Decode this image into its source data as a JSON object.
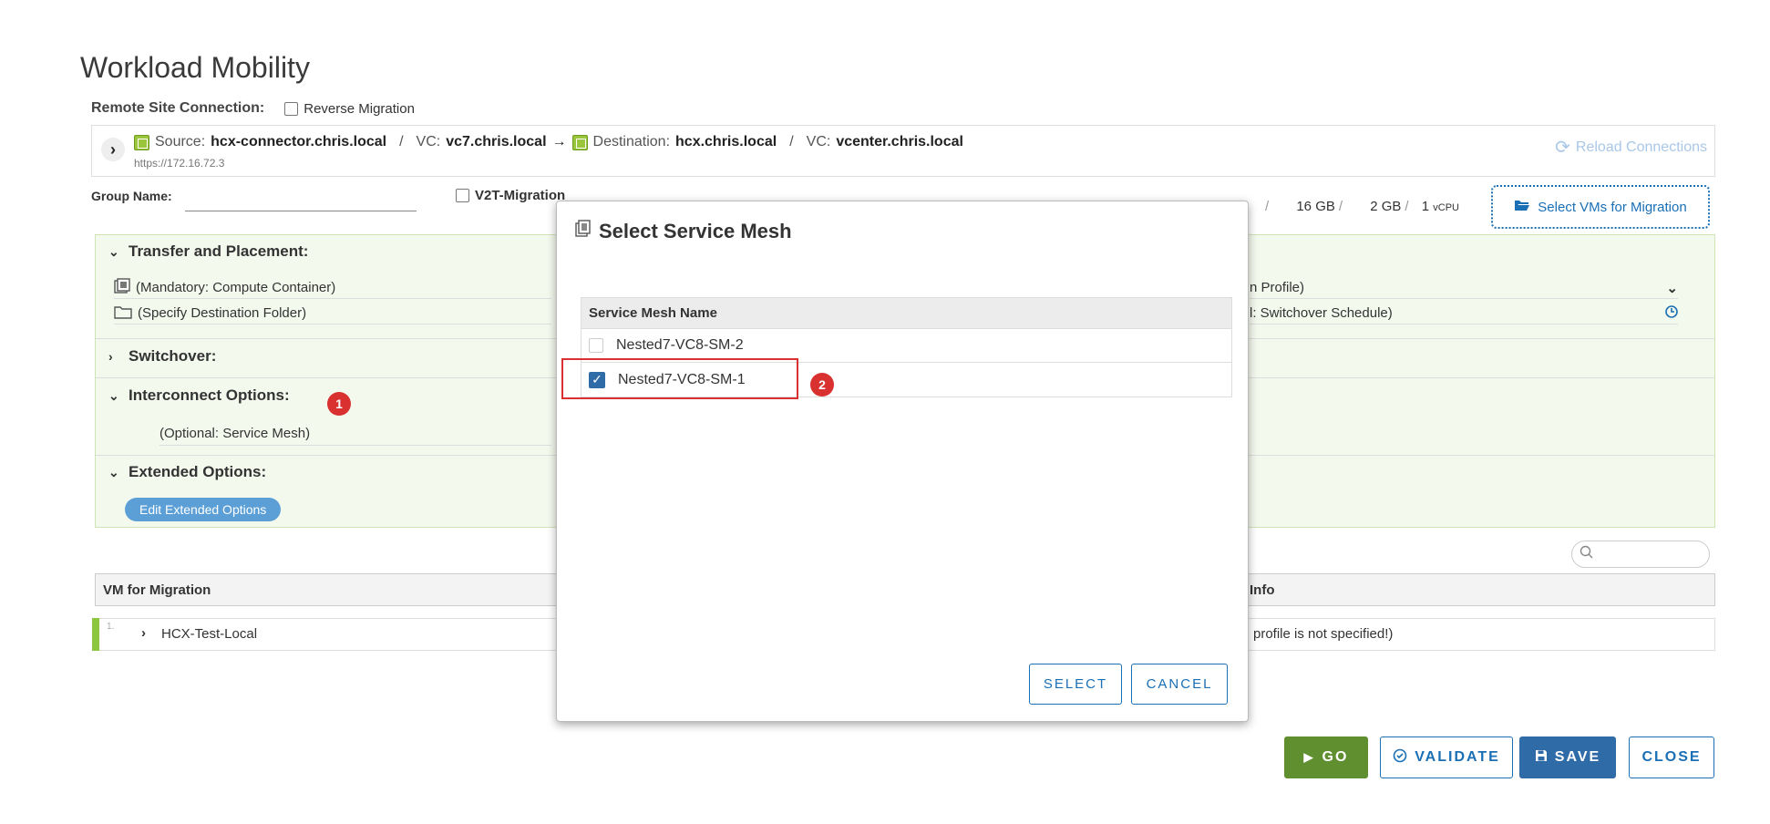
{
  "page": {
    "title": "Workload Mobility"
  },
  "remote_site": {
    "label": "Remote Site Connection:",
    "reverse_migration_label": "Reverse Migration"
  },
  "connection": {
    "source_label": "Source:",
    "source_host": "hcx-connector.chris.local",
    "source_vc_label": "VC:",
    "source_vc": "vc7.chris.local",
    "arrow": "→",
    "destination_label": "Destination:",
    "destination_host": "hcx.chris.local",
    "dest_vc_label": "VC:",
    "dest_vc": "vcenter.chris.local",
    "url": "https://172.16.72.3",
    "reload_label": "Reload Connections"
  },
  "group": {
    "label": "Group Name:",
    "value": "",
    "v2t_label": "V2T-Migration"
  },
  "stats": {
    "slash": "/",
    "storage": "16 GB",
    "memory": "2 GB",
    "cpu_count": "1",
    "cpu_unit": "vCPU"
  },
  "select_vms_label": "Select VMs for Migration",
  "sections": {
    "transfer": {
      "title": "Transfer and Placement:",
      "compute_container": "(Mandatory: Compute Container)",
      "destination_folder": "(Specify Destination Folder)",
      "migration_profile_tail": "n Profile)",
      "switchover_schedule_tail": "l: Switchover Schedule)"
    },
    "switchover": {
      "title": "Switchover:"
    },
    "interconnect": {
      "title": "Interconnect Options:",
      "service_mesh_field": "(Optional: Service Mesh)",
      "badge": "1"
    },
    "extended": {
      "title": "Extended Options:",
      "edit_button": "Edit Extended Options"
    }
  },
  "vm_table": {
    "col_vm": "VM for Migration",
    "col_info": "Info",
    "rows": [
      {
        "index": "1.",
        "name": "HCX-Test-Local",
        "info": "profile is not specified!)"
      }
    ]
  },
  "actions": {
    "go": "GO",
    "validate": "VALIDATE",
    "save": "SAVE",
    "close": "CLOSE"
  },
  "modal": {
    "title": "Select Service Mesh",
    "column": "Service Mesh Name",
    "rows": [
      {
        "name": "Nested7-VC8-SM-2",
        "checked": false
      },
      {
        "name": "Nested7-VC8-SM-1",
        "checked": true
      }
    ],
    "badge": "2",
    "select": "SELECT",
    "cancel": "CANCEL"
  },
  "colors": {
    "accent_blue": "#1a6fb5",
    "go_green": "#5f8f2e",
    "save_blue": "#2f6ba6",
    "annotation_red": "#d9312f",
    "panel_green_bg": "#f4f9ee"
  }
}
